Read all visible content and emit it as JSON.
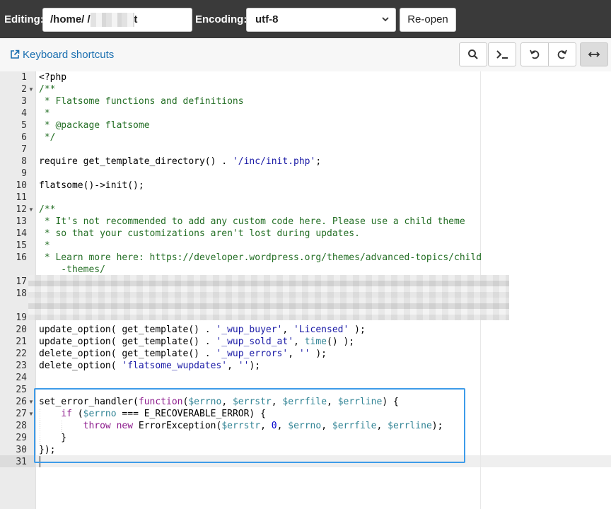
{
  "topbar": {
    "editing_label": "Editing:",
    "path_value": "/home/           /public_ht",
    "encoding_label": "Encoding:",
    "encoding_value": "utf-8",
    "reopen_label": "Re-open"
  },
  "toolbar": {
    "keyboard_shortcuts": "Keyboard shortcuts",
    "buttons": [
      {
        "icon": "search-icon"
      },
      {
        "icon": "terminal-icon"
      },
      {
        "icon": "undo-icon"
      },
      {
        "icon": "redo-icon"
      },
      {
        "icon": "wrap-toggle-icon"
      }
    ]
  },
  "editor": {
    "line_numbers": [
      "1",
      "2",
      "3",
      "4",
      "5",
      "6",
      "7",
      "8",
      "9",
      "10",
      "11",
      "12",
      "13",
      "14",
      "15",
      "16",
      "17",
      "18",
      "19",
      "20",
      "21",
      "22",
      "23",
      "24",
      "25",
      "26",
      "27",
      "28",
      "29",
      "30",
      "31"
    ],
    "lines": {
      "l1": "<?php",
      "l2": "/**",
      "l3": " * Flatsome functions and definitions",
      "l4": " *",
      "l5": " * @package flatsome",
      "l6": " */",
      "l8a": "require get_template_directory() . ",
      "l8b": "'/inc/init.php'",
      "l8c": ";",
      "l10": "flatsome()->init();",
      "l12": "/**",
      "l13": " * It's not recommended to add any custom code here. Please use a child theme",
      "l14": " * so that your customizations aren't lost during updates.",
      "l15": " *",
      "l16": " * Learn more here: https://developer.wordpress.org/themes/advanced-topics/child",
      "l16w": "    -themes/",
      "l20a": "update_option( get_template() . ",
      "l20b": "'_wup_buyer'",
      "l20c": ", ",
      "l20d": "'Licensed'",
      "l20e": " );",
      "l21a": "update_option( get_template() . ",
      "l21b": "'_wup_sold_at'",
      "l21c": ", ",
      "l21d": "time",
      "l21e": "() );",
      "l22a": "delete_option( get_template() . ",
      "l22b": "'_wup_errors'",
      "l22c": ", ",
      "l22d": "''",
      "l22e": " );",
      "l23a": "delete_option( ",
      "l23b": "'flatsome_wupdates'",
      "l23c": ", ",
      "l23d": "''",
      "l23e": ");",
      "l26a": "set_error_handler(",
      "l26b": "function",
      "l26c": "(",
      "l26d": "$errno",
      "l26e": ", ",
      "l26f": "$errstr",
      "l26g": ", ",
      "l26h": "$errfile",
      "l26i": ", ",
      "l26j": "$errline",
      "l26k": ") {",
      "l27a": "    ",
      "l27b": "if",
      "l27c": " (",
      "l27d": "$errno",
      "l27e": " === E_RECOVERABLE_ERROR) {",
      "l28a": "        ",
      "l28b": "throw",
      "l28c": " ",
      "l28d": "new",
      "l28e": " ErrorException(",
      "l28f": "$errstr",
      "l28g": ", ",
      "l28h": "0",
      "l28i": ", ",
      "l28j": "$errno",
      "l28k": ", ",
      "l28l": "$errfile",
      "l28m": ", ",
      "l28n": "$errline",
      "l28o": ");",
      "l29": "    }",
      "l30": "});"
    }
  }
}
